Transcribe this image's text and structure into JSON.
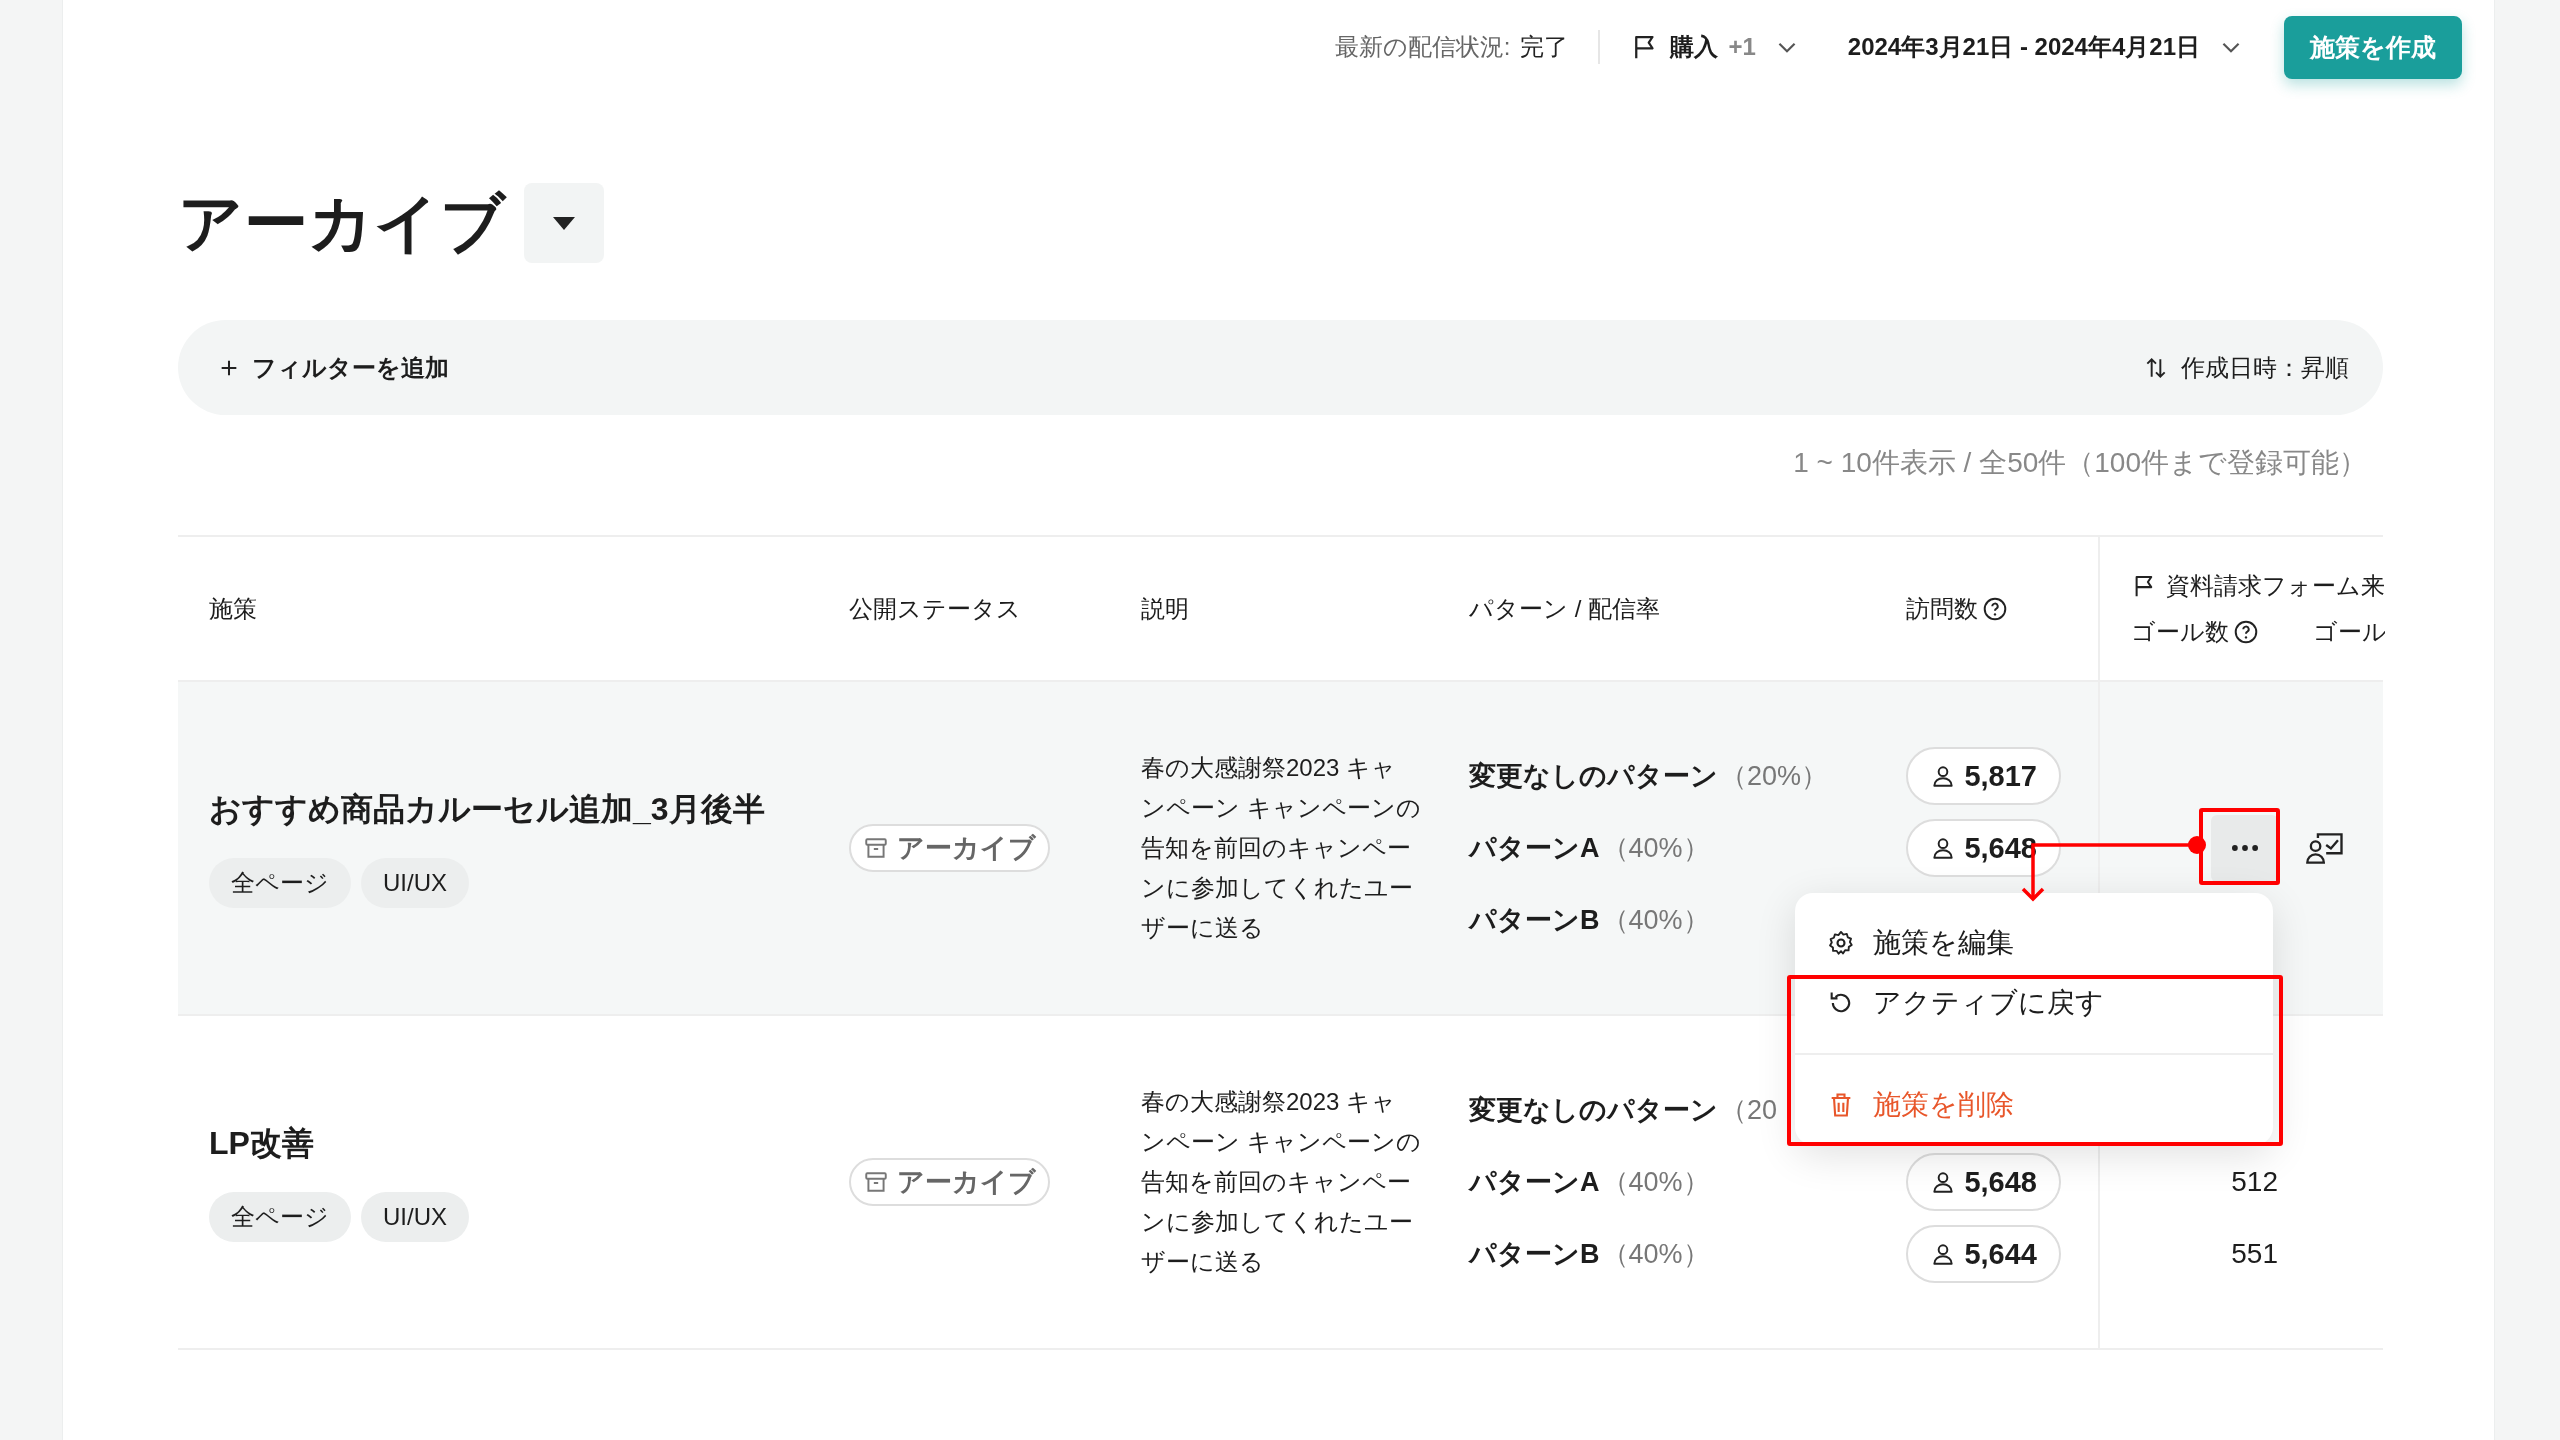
{
  "topbar": {
    "delivery_label": "最新の配信状況:",
    "delivery_value": "完了",
    "goal": {
      "label": "購入",
      "extra": "+1"
    },
    "date_range": "2024年3月21日 - 2024年4月21日",
    "create_button": "施策を作成"
  },
  "page": {
    "title": "アーカイブ"
  },
  "filter": {
    "add_label": "フィルターを追加",
    "sort_label": "作成日時：昇順"
  },
  "count_text": "1 ~ 10件表示 / 全50件（100件まで登録可能）",
  "table": {
    "columns": [
      {
        "label": "施策"
      },
      {
        "label": "公開ステータス"
      },
      {
        "label": "説明"
      },
      {
        "label": "パターン / 配信率"
      },
      {
        "label": "訪問数",
        "help": true
      }
    ],
    "goal_group": {
      "title": "資料請求フォーム来",
      "columns": [
        {
          "label": "ゴール数",
          "help": true
        },
        {
          "label": "ゴール"
        }
      ]
    },
    "rows": [
      {
        "kind": "hovered",
        "name": "おすすめ商品カルーセル追加_3月後半",
        "tags": [
          "全ページ",
          "UI/UX"
        ],
        "status": "アーカイブ",
        "description": "春の大感謝祭2023 キャンペーン キャンペーンの告知を前回のキャンペーンに参加してくれたユーザーに送る",
        "patterns": [
          {
            "name": "変更なしのパターン",
            "rate": "（20%）",
            "visits": "5,817"
          },
          {
            "name": "パターンA",
            "rate": "（40%）",
            "visits": "5,648"
          },
          {
            "name": "パターンB",
            "rate": "（40%）"
          }
        ]
      },
      {
        "kind": "normal",
        "name": "LP改善",
        "tags": [
          "全ページ",
          "UI/UX"
        ],
        "status": "アーカイブ",
        "description": "春の大感謝祭2023 キャンペーン キャンペーンの告知を前回のキャンペーンに参加してくれたユーザーに送る",
        "patterns": [
          {
            "name": "変更なしのパターン",
            "rate": "（20"
          },
          {
            "name": "パターンA",
            "rate": "（40%）",
            "visits": "5,648",
            "goal": "512"
          },
          {
            "name": "パターンB",
            "rate": "（40%）",
            "visits": "5,644",
            "goal": "551"
          }
        ]
      }
    ]
  },
  "context_menu": {
    "items": [
      {
        "kind": "edit",
        "label": "施策を編集"
      },
      {
        "kind": "restore",
        "label": "アクティブに戻す"
      },
      {
        "kind": "delete",
        "label": "施策を削除"
      }
    ]
  }
}
